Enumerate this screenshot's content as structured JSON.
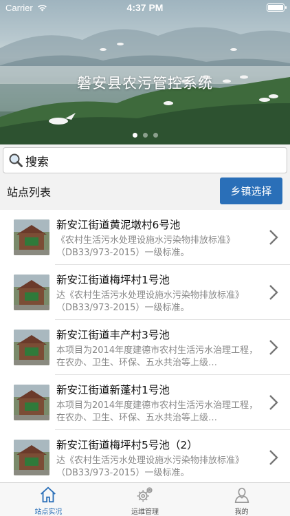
{
  "status_bar": {
    "carrier": "Carrier",
    "time": "4:37 PM",
    "battery_level": 1.0
  },
  "banner": {
    "title": "磐安县农污管控系统",
    "page_count": 3,
    "active_page": 0
  },
  "search": {
    "placeholder": "搜索"
  },
  "list_header": {
    "title": "站点列表",
    "town_button_label": "乡镇选择"
  },
  "stations": [
    {
      "title": "新安江街道黄泥墩村6号池",
      "description": "《农村生活污水处理设施水污染物排放标准》（DB33/973-2015）一级标准。"
    },
    {
      "title": "新安江街道梅坪村1号池",
      "description": "达《农村生活污水处理设施水污染物排放标准》（DB33/973-2015）一级标准。"
    },
    {
      "title": "新安江街道丰产村3号池",
      "description": "本项目为2014年度建德市农村生活污水治理工程，在农办、卫生、环保、五水共治等上级…"
    },
    {
      "title": "新安江街道新蓬村1号池",
      "description": "本项目为2014年度建德市农村生活污水治理工程，在农办、卫生、环保、五水共治等上级…"
    },
    {
      "title": "新安江街道梅坪村5号池（2）",
      "description": "达《农村生活污水处理设施水污染物排放标准》（DB33/973-2015）一级标准。"
    }
  ],
  "tabbar": {
    "tabs": [
      {
        "label": "站点实况",
        "icon": "home-icon",
        "active": true
      },
      {
        "label": "运维管理",
        "icon": "gear-icon",
        "active": false
      },
      {
        "label": "我的",
        "icon": "user-icon",
        "active": false
      }
    ]
  },
  "colors": {
    "accent": "#2a6fb8",
    "banner_title": "#ffffff"
  }
}
